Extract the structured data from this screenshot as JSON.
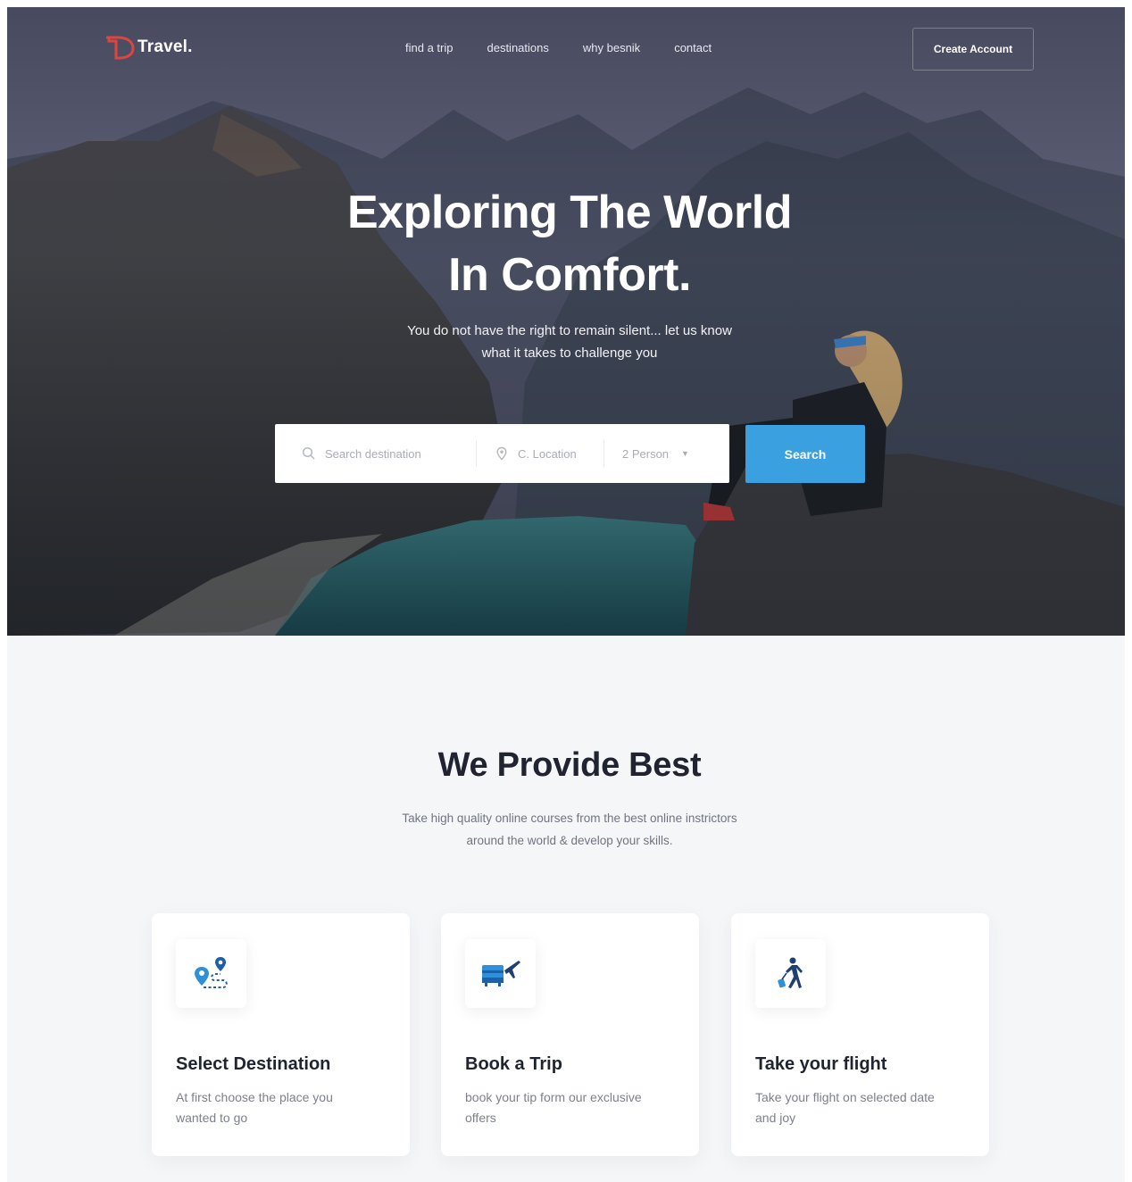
{
  "header": {
    "logo_mark": "D",
    "logo_text": "Travel.",
    "nav": [
      {
        "label": "find a trip"
      },
      {
        "label": "destinations"
      },
      {
        "label": "why besnik"
      },
      {
        "label": "contact"
      }
    ],
    "cta_label": "Create Account"
  },
  "hero": {
    "title_line1": "Exploring The World",
    "title_line2": "In Comfort.",
    "subtitle_line1": "You do not have the right to remain silent... let us know",
    "subtitle_line2": "what it takes to challenge you",
    "search": {
      "destination_placeholder": "Search destination",
      "location_placeholder": "C. Location",
      "persons_value": "2 Person",
      "button_label": "Search",
      "button_color": "#3aa0e0"
    }
  },
  "features": {
    "title": "We Provide Best",
    "subtitle_line1": "Take high quality online courses from the best online instrictors",
    "subtitle_line2": "around the world & develop your skills.",
    "cards": [
      {
        "icon": "map-pin-route-icon",
        "title": "Select Destination",
        "description": "At first choose the place you wanted to go"
      },
      {
        "icon": "airplane-ticket-icon",
        "title": "Book a Trip",
        "description": "book your tip form our exclusive offers"
      },
      {
        "icon": "traveler-walking-icon",
        "title": "Take your flight",
        "description": "Take your flight on selected date and joy"
      }
    ]
  },
  "colors": {
    "accent": "#3aa0e0",
    "logo_red": "#e0443a",
    "heading": "#1f2430"
  }
}
